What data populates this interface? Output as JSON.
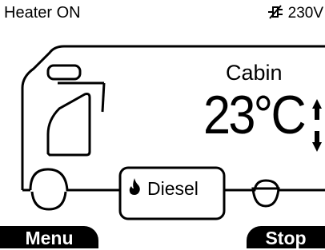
{
  "status": {
    "heater_state": "Heater ON",
    "power_source": "230V",
    "power_icon": "plug-icon"
  },
  "cabin": {
    "label": "Cabin",
    "temperature": "23°C",
    "adjust_icon": "up-down-arrows-icon"
  },
  "fuel": {
    "label": "Diesel",
    "icon": "flame-icon"
  },
  "softkeys": {
    "left_label": "Menu",
    "right_label": "Stop"
  }
}
